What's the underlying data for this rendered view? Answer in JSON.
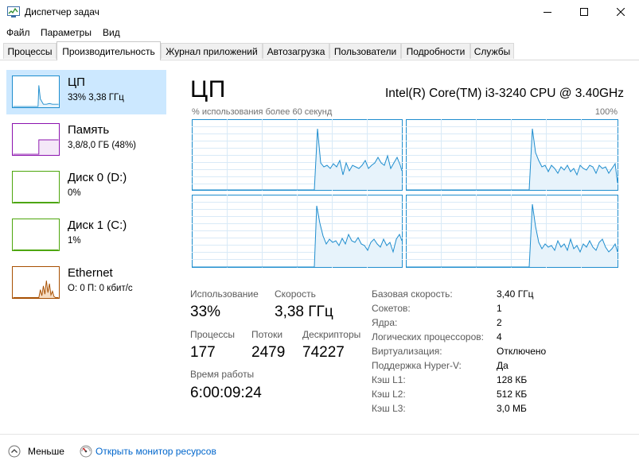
{
  "window": {
    "title": "Диспетчер задач"
  },
  "menu": [
    "Файл",
    "Параметры",
    "Вид"
  ],
  "tabs": [
    "Процессы",
    "Производительность",
    "Журнал приложений",
    "Автозагрузка",
    "Пользователи",
    "Подробности",
    "Службы"
  ],
  "sidebar": [
    {
      "title": "ЦП",
      "sub": "33% 3,38 ГГц",
      "color": "#1e8dce"
    },
    {
      "title": "Память",
      "sub": "3,8/8,0 ГБ (48%)",
      "color": "#8b12ae"
    },
    {
      "title": "Диск 0 (D:)",
      "sub": "0%",
      "color": "#4da60c"
    },
    {
      "title": "Диск 1 (C:)",
      "sub": "1%",
      "color": "#4da60c"
    },
    {
      "title": "Ethernet",
      "sub": "О: 0 П: 0 кбит/с",
      "color": "#a74f01"
    }
  ],
  "main": {
    "heading": "ЦП",
    "cpu_name": "Intel(R) Core(TM) i3-3240 CPU @ 3.40GHz",
    "graph_label": "% использования более 60 секунд",
    "graph_max": "100%",
    "graph_color": "#1e8dce",
    "stats": {
      "usage_label": "Использование",
      "usage": "33%",
      "speed_label": "Скорость",
      "speed": "3,38 ГГц",
      "processes_label": "Процессы",
      "processes": "177",
      "threads_label": "Потоки",
      "threads": "2479",
      "handles_label": "Дескрипторы",
      "handles": "74227",
      "uptime_label": "Время работы",
      "uptime": "6:00:09:24"
    },
    "specs": [
      {
        "label": "Базовая скорость:",
        "value": "3,40 ГГц"
      },
      {
        "label": "Сокетов:",
        "value": "1"
      },
      {
        "label": "Ядра:",
        "value": "2"
      },
      {
        "label": "Логических процессоров:",
        "value": "4"
      },
      {
        "label": "Виртуализация:",
        "value": "Отключено"
      },
      {
        "label": "Поддержка Hyper-V:",
        "value": "Да"
      },
      {
        "label": "Кэш L1:",
        "value": "128 КБ"
      },
      {
        "label": "Кэш L2:",
        "value": "512 КБ"
      },
      {
        "label": "Кэш L3:",
        "value": "3,0 МБ"
      }
    ]
  },
  "footer": {
    "less": "Меньше",
    "monitor": "Открыть монитор ресурсов"
  }
}
